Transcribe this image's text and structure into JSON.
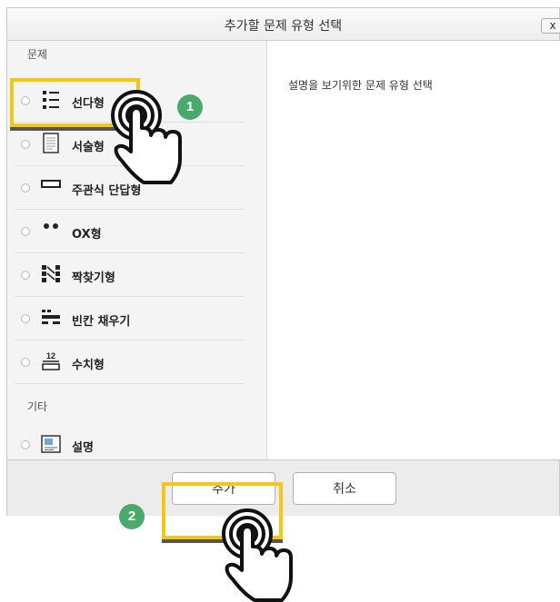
{
  "dialog": {
    "title": "추가할 문제 유형 선택",
    "close_label": "x"
  },
  "sidebar": {
    "section_questions": "문제",
    "section_other": "기타",
    "items": [
      {
        "label": "선다형",
        "icon": "multiple-choice-icon"
      },
      {
        "label": "서술형",
        "icon": "essay-icon"
      },
      {
        "label": "주관식 단답형",
        "icon": "short-answer-icon"
      },
      {
        "label": "OX형",
        "icon": "ox-icon"
      },
      {
        "label": "짝찾기형",
        "icon": "matching-icon"
      },
      {
        "label": "빈칸 채우기",
        "icon": "fill-blank-icon"
      },
      {
        "label": "수치형",
        "icon": "numeric-icon",
        "icon_text": "12"
      }
    ],
    "other_items": [
      {
        "label": "설명",
        "icon": "description-icon"
      }
    ]
  },
  "main": {
    "description": "설명을 보기위한 문제 유형 선택"
  },
  "footer": {
    "add_label": "추가",
    "cancel_label": "취소"
  },
  "annotations": {
    "step1": "1",
    "step2": "2",
    "highlight_color": "#f5c518",
    "badge_color": "#4aaa6b"
  }
}
